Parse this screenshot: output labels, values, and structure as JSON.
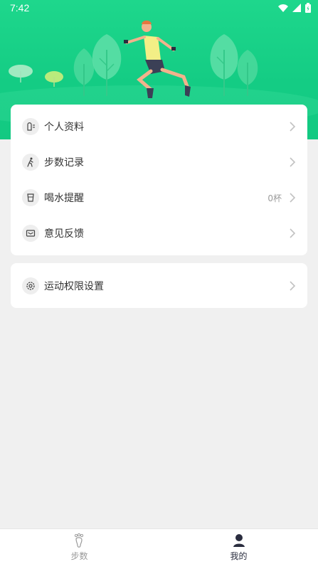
{
  "status": {
    "time": "7:42"
  },
  "colors": {
    "accent": "#17cf86",
    "tab_active": "#2a2d3f",
    "tab_inactive": "#9a9a9a"
  },
  "menu1": [
    {
      "label": "个人资料",
      "icon": "profile-icon",
      "value": ""
    },
    {
      "label": "步数记录",
      "icon": "walk-icon",
      "value": ""
    },
    {
      "label": "喝水提醒",
      "icon": "cup-icon",
      "value": "0杯"
    },
    {
      "label": "意见反馈",
      "icon": "mail-icon",
      "value": ""
    }
  ],
  "menu2": [
    {
      "label": "运动权限设置",
      "icon": "gear-icon",
      "value": ""
    }
  ],
  "tabs": [
    {
      "label": "步数",
      "icon": "footprint-icon",
      "active": false
    },
    {
      "label": "我的",
      "icon": "person-icon",
      "active": true
    }
  ]
}
